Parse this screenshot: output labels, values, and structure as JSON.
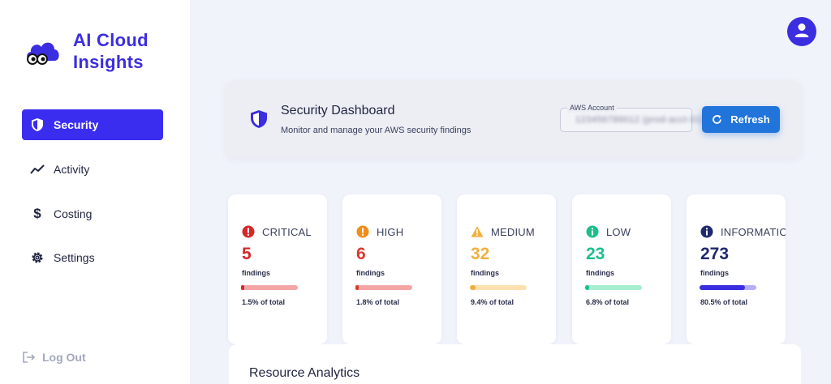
{
  "brand": {
    "line1": "AI Cloud",
    "line2": "Insights",
    "icon": "cloud-eyes-logo",
    "color": "#3b2de0"
  },
  "sidebar": {
    "items": [
      {
        "label": "Security",
        "icon": "shield-icon",
        "active": true
      },
      {
        "label": "Activity",
        "icon": "trend-icon",
        "active": false
      },
      {
        "label": "Costing",
        "icon": "dollar-icon",
        "active": false
      },
      {
        "label": "Settings",
        "icon": "gear-icon",
        "active": false
      }
    ],
    "logout": {
      "label": "Log Out",
      "icon": "logout-icon"
    }
  },
  "header": {
    "title": "Security Dashboard",
    "subtitle": "Monitor and manage your AWS security findings",
    "account_label": "AWS Account",
    "account_value": "123456789012 (prod-acct-01)",
    "refresh_label": "Refresh"
  },
  "severity": [
    {
      "name": "CRITICAL",
      "count": "5",
      "findings_label": "findings",
      "percent": 1.5,
      "percent_text": "1.5% of total",
      "color": "#d62828",
      "track": "#f4a6a6",
      "icon": "exclamation-circle-icon"
    },
    {
      "name": "HIGH",
      "count": "6",
      "findings_label": "findings",
      "percent": 1.8,
      "percent_text": "1.8% of total",
      "color": "#d93a2b",
      "track": "#f4a6a6",
      "icon": "warning-circle-icon"
    },
    {
      "name": "MEDIUM",
      "count": "32",
      "findings_label": "findings",
      "percent": 9.4,
      "percent_text": "9.4% of total",
      "color": "#f0b040",
      "track": "#fde2b0",
      "icon": "warning-triangle-icon"
    },
    {
      "name": "LOW",
      "count": "23",
      "findings_label": "findings",
      "percent": 6.8,
      "percent_text": "6.8% of total",
      "color": "#1cbf8a",
      "track": "#a6eecf",
      "icon": "info-circle-icon"
    },
    {
      "name": "INFORMATIONAL",
      "count": "273",
      "findings_label": "findings",
      "percent": 80.5,
      "percent_text": "80.5% of total",
      "color": "#1f2a6e",
      "track": "#b5b0f5",
      "icon": "info-dark-circle-icon"
    }
  ],
  "resource_analytics": {
    "title": "Resource Analytics"
  }
}
